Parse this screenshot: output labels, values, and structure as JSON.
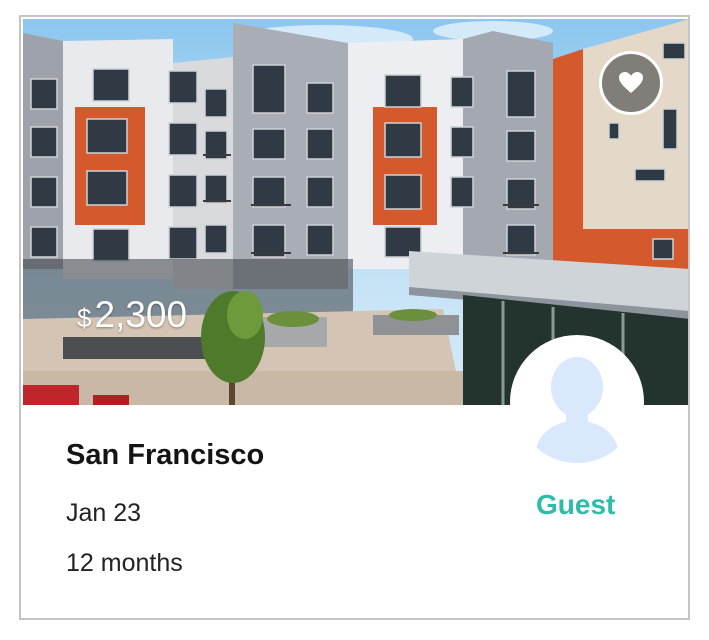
{
  "listing": {
    "price_currency": "$",
    "price_amount": "2,300",
    "city": "San Francisco",
    "date": "Jan 23",
    "duration": "12 months",
    "role": "Guest"
  },
  "icons": {
    "favorite": "heart-icon",
    "avatar": "person-silhouette-icon"
  },
  "colors": {
    "role_accent": "#2bbcaa",
    "facade_orange": "#d45a2e",
    "avatar_tint": "#d9e8fb"
  }
}
